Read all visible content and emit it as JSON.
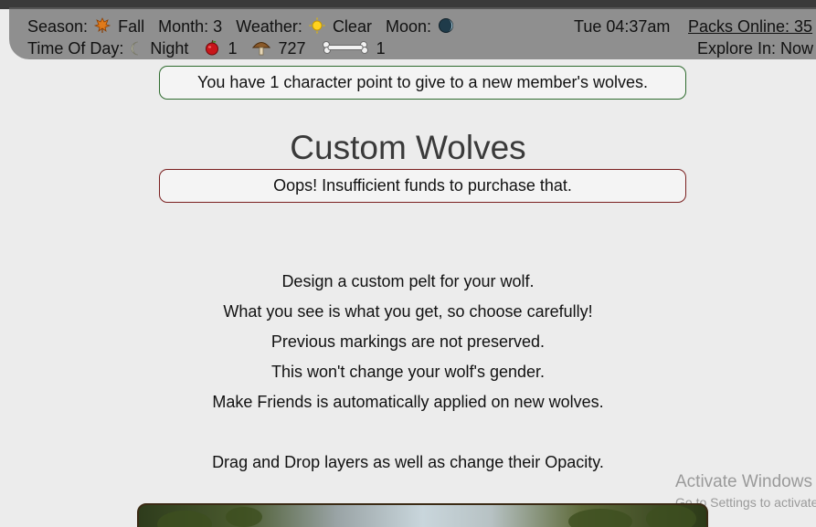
{
  "status": {
    "season_label": "Season:",
    "season_value": "Fall",
    "month_label": "Month:",
    "month_value": "3",
    "weather_label": "Weather:",
    "weather_value": "Clear",
    "moon_label": "Moon:",
    "time_of_day_label": "Time Of Day:",
    "time_of_day_value": "Night",
    "apples": "1",
    "mushrooms": "727",
    "bones": "1",
    "clock": "Tue 04:37am",
    "packs_online": "Packs Online: 35",
    "explore": "Explore In: Now"
  },
  "notices": {
    "character_points": "You have 1 character point to give to a new member's wolves.",
    "error": "Oops! Insufficient funds to purchase that."
  },
  "page_title": "Custom Wolves",
  "description": [
    "Design a custom pelt for your wolf.",
    "What you see is what you get, so choose carefully!",
    "Previous markings are not preserved.",
    "This won't change your wolf's gender.",
    "Make Friends is automatically applied on new wolves.",
    "Drag and Drop layers as well as change their Opacity."
  ],
  "watermark": {
    "line1": "Activate Windows",
    "line2": "Go to Settings to activate Windows."
  },
  "colors": {
    "status_bar": "#8f8f8f",
    "page_bg": "#ececec",
    "notice_green_border": "#2e6b2e",
    "notice_red_border": "#7a1f1f"
  }
}
